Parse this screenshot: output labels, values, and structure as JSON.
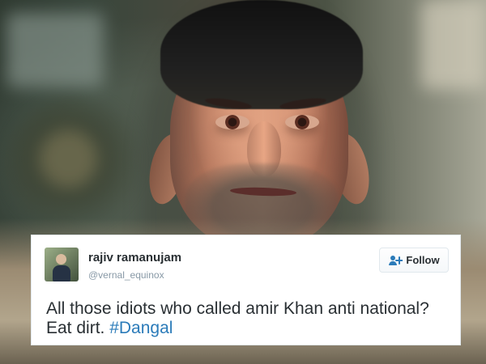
{
  "tweet": {
    "user": {
      "name": "rajiv ramanujam",
      "handle": "@vernal_equinox"
    },
    "follow_button": {
      "label": "Follow",
      "icon": "follow-user-icon"
    },
    "text": "All those idiots who called  amir Khan anti national? Eat dirt. ",
    "hashtag": "#Dangal"
  },
  "colors": {
    "card_background": "#ffffff",
    "card_border": "#e1e8ed",
    "name_text": "#292f33",
    "handle_text": "#8899a6",
    "hashtag": "#2b7bb9",
    "follow_icon": "#2b7bb9"
  }
}
